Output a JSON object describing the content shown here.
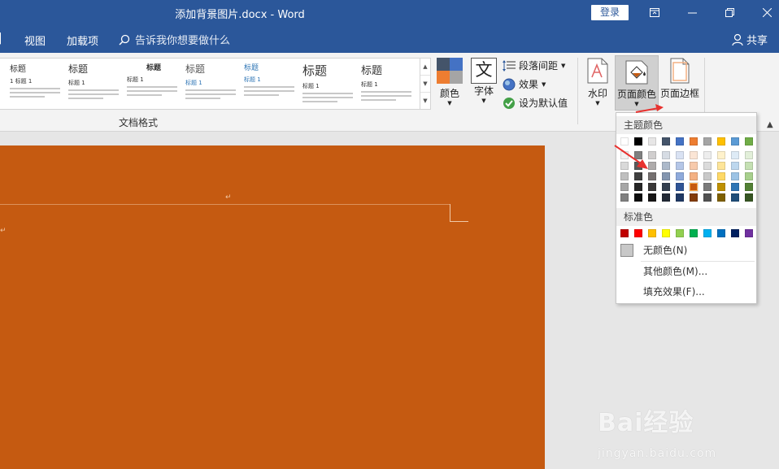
{
  "window": {
    "title": "添加背景图片.docx  -  Word",
    "login_label": "登录",
    "controls": [
      "ribbon-display-icon",
      "minimize-icon",
      "restore-icon",
      "close-icon"
    ]
  },
  "tabs": {
    "items": [
      "视图",
      "加载项"
    ],
    "tell_me": "告诉我你想要做什么",
    "share": "共享"
  },
  "ribbon": {
    "gallery_styles": [
      {
        "heading": "标题",
        "sub": "1 标题 1"
      },
      {
        "heading": "标题",
        "sub": "标题 1"
      },
      {
        "heading": "标题",
        "sub": "标题 1"
      },
      {
        "heading": "标题",
        "sub": "标题 1"
      },
      {
        "heading": "标题",
        "sub": "标题 1"
      },
      {
        "heading": "标题",
        "sub": "标题 1"
      },
      {
        "heading": "标题",
        "sub": "标题 1"
      }
    ],
    "group_label": "文档格式",
    "colors_label": "颜色",
    "fonts_label": "字体",
    "fonts_glyph": "文",
    "paragraph_spacing": "段落间距",
    "effects": "效果",
    "set_default": "设为默认值",
    "watermark": "水印",
    "page_color": "页面颜色",
    "page_borders": "页面边框"
  },
  "page_color_menu": {
    "theme_header": "主题颜色",
    "standard_header": "标准色",
    "no_color": "无颜色(N)",
    "more_colors": "其他颜色(M)...",
    "fill_effects": "填充效果(F)...",
    "theme_top": [
      "#ffffff",
      "#000000",
      "#e7e6e6",
      "#44546a",
      "#4472c4",
      "#ed7d31",
      "#a5a5a5",
      "#ffc000",
      "#5b9bd5",
      "#70ad47"
    ],
    "theme_shades": [
      [
        "#f2f2f2",
        "#d9d9d9",
        "#bfbfbf",
        "#a6a6a6",
        "#808080"
      ],
      [
        "#808080",
        "#595959",
        "#404040",
        "#262626",
        "#0d0d0d"
      ],
      [
        "#d0cece",
        "#aeabab",
        "#757070",
        "#3a3838",
        "#171616"
      ],
      [
        "#d6dce4",
        "#acb9ca",
        "#8496b0",
        "#333f4f",
        "#222a35"
      ],
      [
        "#d9e2f3",
        "#b4c6e7",
        "#8eaadb",
        "#2f5496",
        "#1f3864"
      ],
      [
        "#fbe5d5",
        "#f7caac",
        "#f4b183",
        "#c55a11",
        "#833c0b"
      ],
      [
        "#ededed",
        "#dbdbdb",
        "#c9c9c9",
        "#7b7b7b",
        "#525252"
      ],
      [
        "#fff2cc",
        "#fee599",
        "#ffd966",
        "#bf9000",
        "#7f6000"
      ],
      [
        "#deebf6",
        "#bdd7ee",
        "#9cc3e5",
        "#2e75b5",
        "#1f4e79"
      ],
      [
        "#e2efd9",
        "#c5e0b3",
        "#a8d08d",
        "#538135",
        "#375623"
      ]
    ],
    "selected_color": "#c55a11",
    "standard": [
      "#c00000",
      "#ff0000",
      "#ffc000",
      "#ffff00",
      "#92d050",
      "#00b050",
      "#00b0f0",
      "#0070c0",
      "#002060",
      "#7030a0"
    ]
  },
  "document": {
    "page_color": "#c55a11",
    "para_mark": "↵"
  },
  "watermark": {
    "main": "Bai经验",
    "sub": "jingyan.baidu.com"
  },
  "colors": {
    "word_blue": "#2b579a",
    "annotation_red": "#e8322f"
  }
}
